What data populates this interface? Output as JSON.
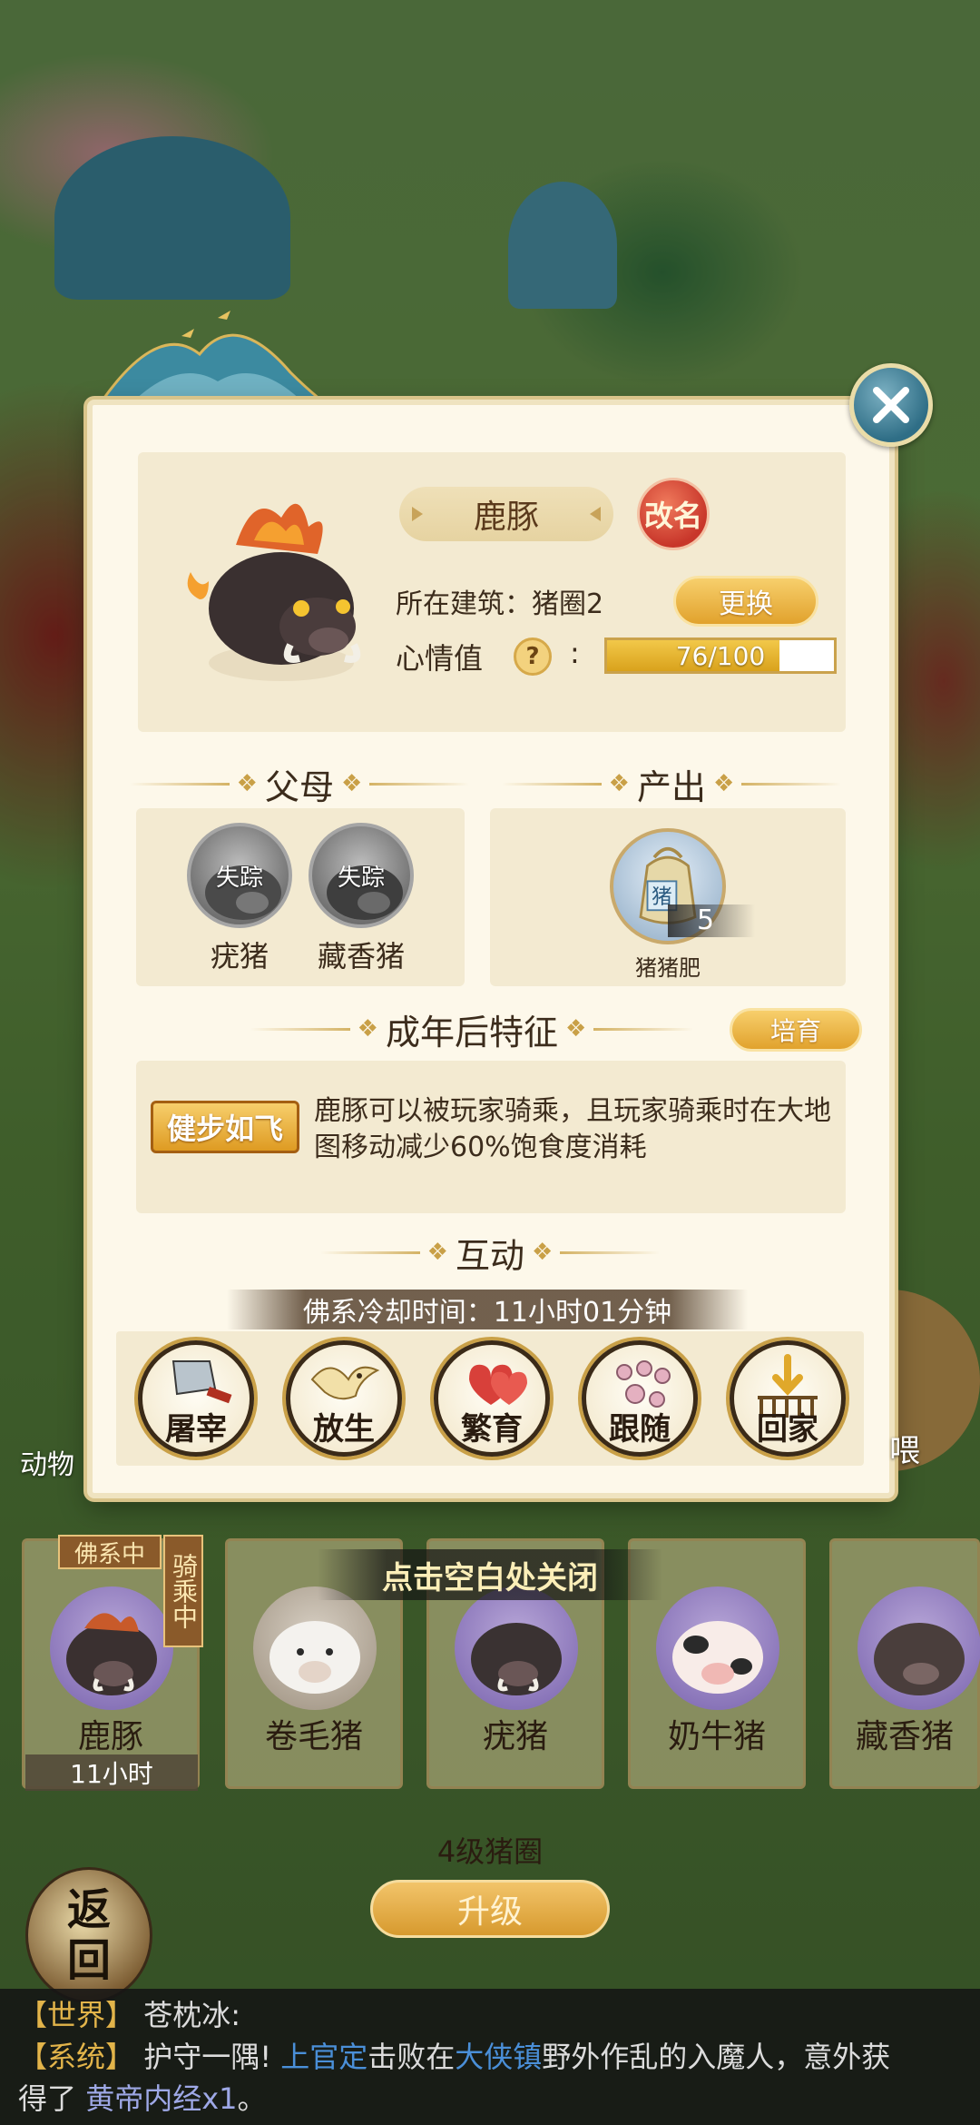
{
  "pet": {
    "name": "鹿豚",
    "rename_label": "改名",
    "building_label": "所在建筑：猪圈2",
    "change_label": "更换",
    "mood_label": "心情值",
    "mood_text": "76/100",
    "mood_fraction": 0.76
  },
  "parents": {
    "header": "父母",
    "items": [
      {
        "status": "失踪",
        "name": "疣猪"
      },
      {
        "status": "失踪",
        "name": "藏香猪"
      }
    ]
  },
  "output": {
    "header": "产出",
    "item_tag": "猪",
    "count": "5",
    "name": "猪猪肥"
  },
  "traits": {
    "header": "成年后特征",
    "cultivate_label": "培育",
    "badge": "健步如飞",
    "description": "鹿豚可以被玩家骑乘，且玩家骑乘时在大地图移动减少60%饱食度消耗"
  },
  "interaction": {
    "header": "互动",
    "cooldown": "佛系冷却时间：11小时01分钟",
    "actions": [
      {
        "label": "屠宰",
        "icon": "cleaver-icon"
      },
      {
        "label": "放生",
        "icon": "bird-icon"
      },
      {
        "label": "繁育",
        "icon": "hearts-icon"
      },
      {
        "label": "跟随",
        "icon": "paw-prints-icon"
      },
      {
        "label": "回家",
        "icon": "home-arrow-icon"
      }
    ]
  },
  "bottom": {
    "hint": "点击空白处关闭",
    "animal_label": "动物",
    "right_stub": "喂",
    "buddhist_tag": "佛系中",
    "riding_tag": "骑乘中",
    "active_time": "11小时",
    "pets": [
      "鹿豚",
      "卷毛猪",
      "疣猪",
      "奶牛猪",
      "藏香猪"
    ],
    "pen_level": "4级猪圈",
    "upgrade_label": "升级",
    "return_label_1": "返",
    "return_label_2": "回"
  },
  "chat": {
    "line1_channel": "【世界】",
    "line1_user": "苍枕冰:",
    "line2_channel": "【系统】",
    "line2_text_a": "护守一隅!",
    "line2_player": "上官定",
    "line2_text_b": "击败在",
    "line2_place": "大侠镇",
    "line2_text_c": "野外作乱的入魔人，意外获",
    "line3_text_a": "得了",
    "line3_item": "黄帝内经x1",
    "line3_text_b": "。"
  },
  "colors": {
    "accent_gold": "#e1a22d",
    "close_teal": "#2f6e86",
    "rename_red": "#c8362a",
    "chat_blue": "#4a8fd8"
  }
}
